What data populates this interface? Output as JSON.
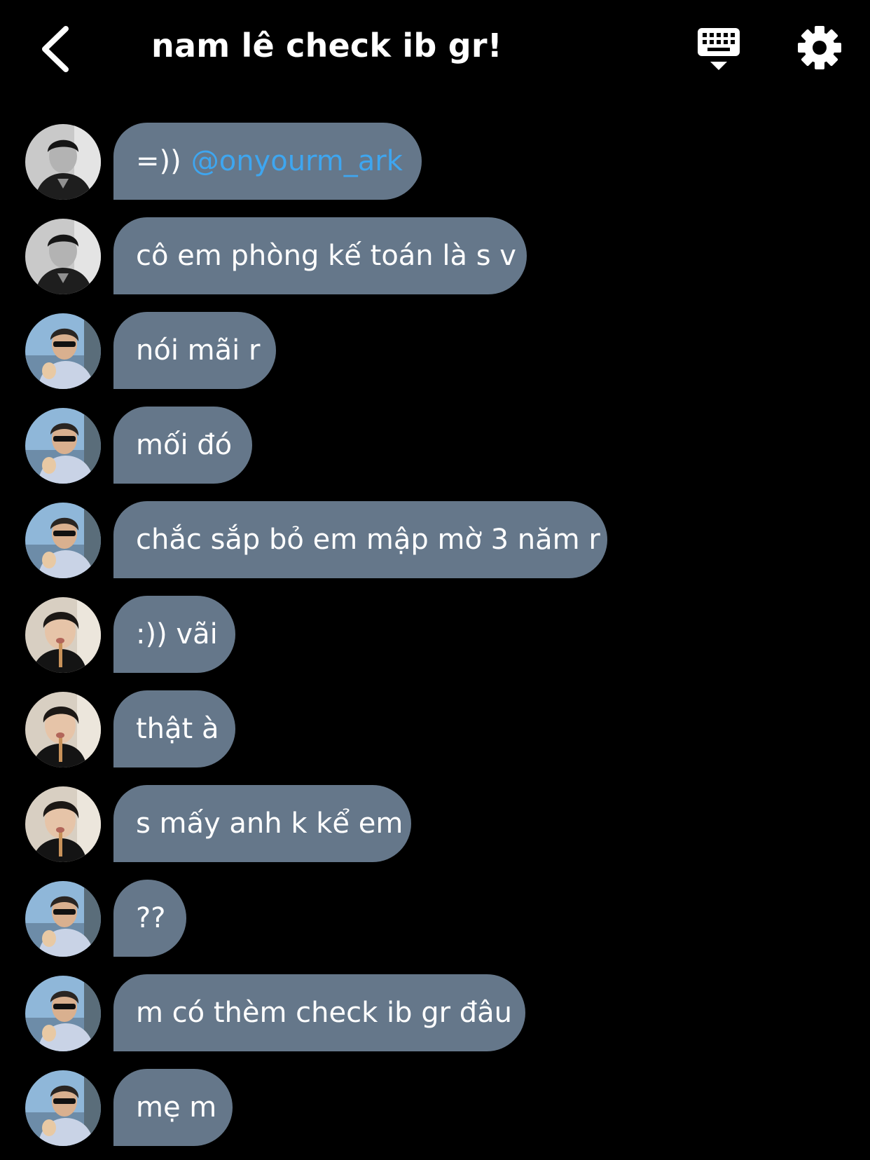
{
  "header": {
    "title": "nam lê check ib gr!",
    "back_icon": "chevron-left-icon",
    "keyboard_icon": "keyboard-icon",
    "settings_icon": "gear-icon"
  },
  "colors": {
    "background": "#000000",
    "bubble": "#65778a",
    "mention": "#3ea6f0",
    "text": "#ffffff"
  },
  "messages": [
    {
      "avatar": "avatar-monochrome-person",
      "text": "=))",
      "mention": "@onyourm_ark"
    },
    {
      "avatar": "avatar-monochrome-person",
      "text": "cô em phòng kế toán là s v"
    },
    {
      "avatar": "avatar-sunglasses-person",
      "text": "nói mãi r"
    },
    {
      "avatar": "avatar-sunglasses-person",
      "text": "mối đó"
    },
    {
      "avatar": "avatar-sunglasses-person",
      "text": "chắc sắp bỏ em mập mờ 3 năm r"
    },
    {
      "avatar": "avatar-straw-person",
      "text": ":)) vãi"
    },
    {
      "avatar": "avatar-straw-person",
      "text": "thật à"
    },
    {
      "avatar": "avatar-straw-person",
      "text": "s mấy anh k kể em"
    },
    {
      "avatar": "avatar-sunglasses-person",
      "text": "??"
    },
    {
      "avatar": "avatar-sunglasses-person",
      "text": "m có thèm check ib gr đâu"
    },
    {
      "avatar": "avatar-sunglasses-person",
      "text": "mẹ m"
    }
  ]
}
